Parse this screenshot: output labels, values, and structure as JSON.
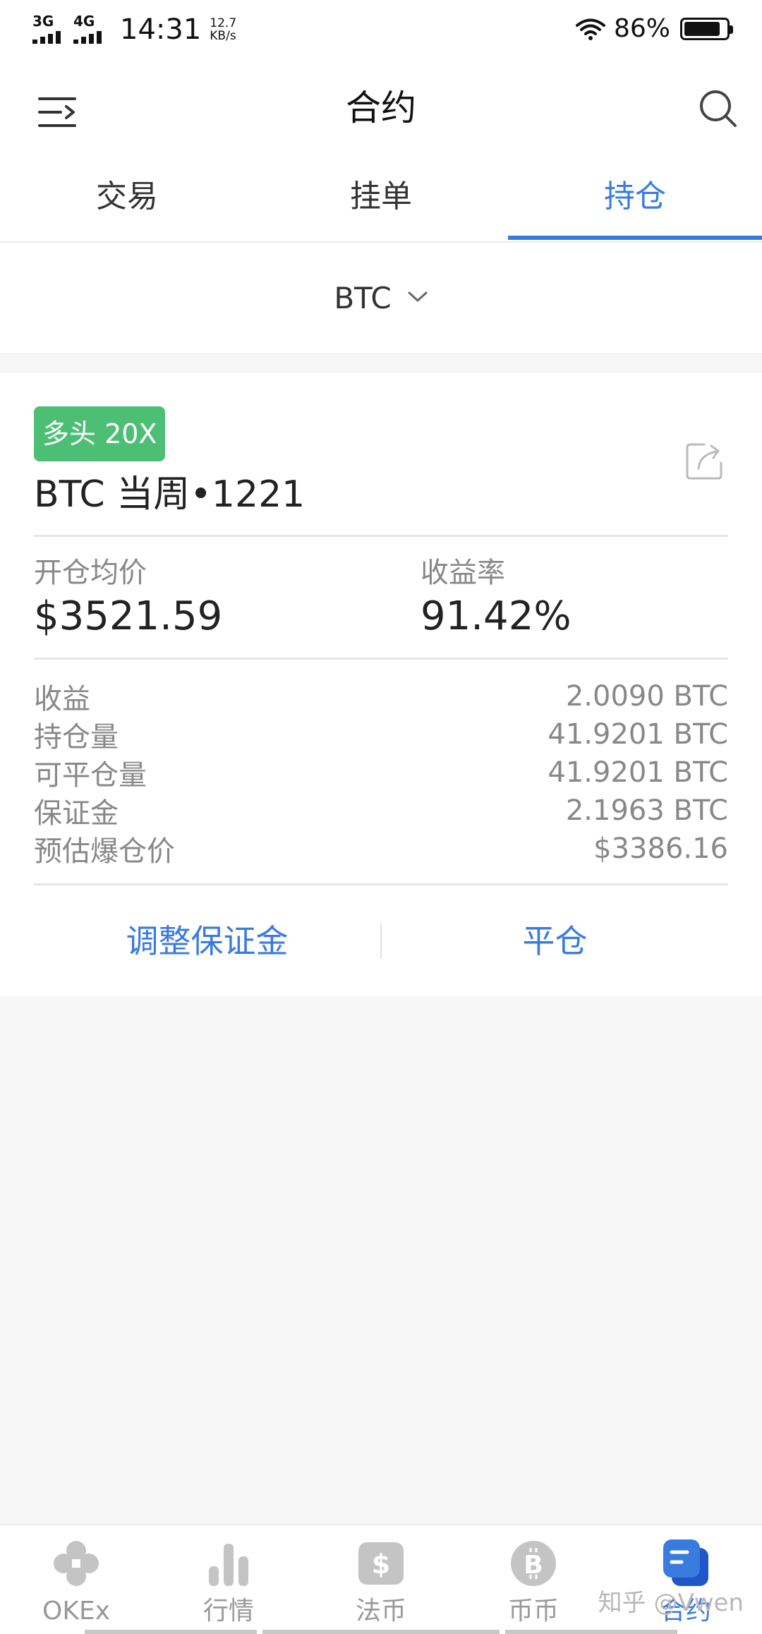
{
  "status_bar": {
    "net1": "3G",
    "net2": "4G",
    "time": "14:31",
    "speed_value": "12.7",
    "speed_unit": "KB/s",
    "battery": "86%"
  },
  "header": {
    "title": "合约"
  },
  "tabs": [
    {
      "label": "交易",
      "active": false
    },
    {
      "label": "挂单",
      "active": false
    },
    {
      "label": "持仓",
      "active": true
    }
  ],
  "selector": {
    "currency": "BTC"
  },
  "position": {
    "badge": "多头 20X",
    "contract": "BTC 当周•1221",
    "avg_price_label": "开仓均价",
    "avg_price_value": "$3521.59",
    "return_label": "收益率",
    "return_value": "91.42%",
    "details": [
      {
        "label": "收益",
        "value": "2.0090 BTC"
      },
      {
        "label": "持仓量",
        "value": "41.9201 BTC"
      },
      {
        "label": "可平仓量",
        "value": "41.9201 BTC"
      },
      {
        "label": "保证金",
        "value": "2.1963 BTC"
      },
      {
        "label": "预估爆仓价",
        "value": "$3386.16"
      }
    ],
    "actions": {
      "adjust_margin": "调整保证金",
      "close": "平仓"
    }
  },
  "bottom_nav": [
    {
      "label": "OKEx",
      "icon": "okex-logo-icon",
      "active": false
    },
    {
      "label": "行情",
      "icon": "bar-chart-icon",
      "active": false
    },
    {
      "label": "法币",
      "icon": "dollar-icon",
      "active": false
    },
    {
      "label": "币币",
      "icon": "bitcoin-icon",
      "active": false
    },
    {
      "label": "合约",
      "icon": "contract-icon",
      "active": true
    }
  ],
  "watermark": "知乎 @Vwen",
  "colors": {
    "accent": "#3a7be0",
    "long_badge": "#4cbf75",
    "muted_text": "#888888"
  }
}
